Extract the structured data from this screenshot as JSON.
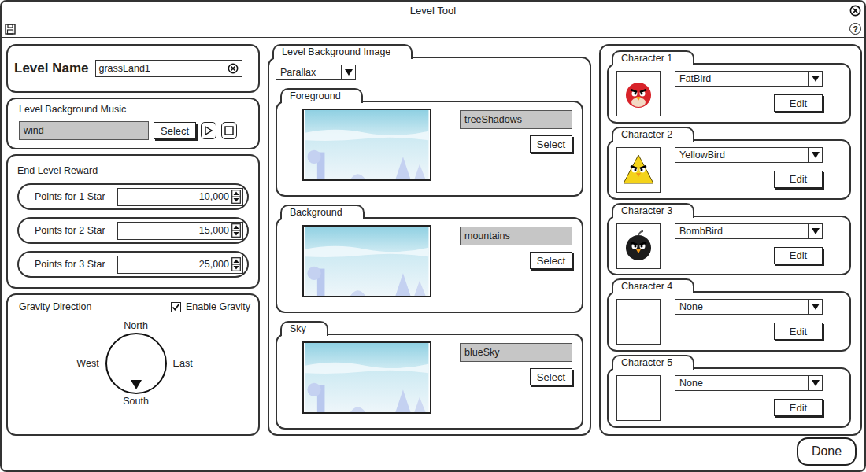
{
  "window": {
    "title": "Level Tool"
  },
  "toolbar": {
    "help": "?"
  },
  "levelName": {
    "label": "Level Name",
    "value": "grassLand1"
  },
  "music": {
    "title": "Level Background Music",
    "value": "wind",
    "button": "Select"
  },
  "reward": {
    "title": "End Level Reward",
    "rows": [
      {
        "label": "Points for 1 Star",
        "value": "10,000"
      },
      {
        "label": "Points for 2 Star",
        "value": "15,000"
      },
      {
        "label": "Points for 3 Star",
        "value": "25,000"
      }
    ]
  },
  "gravity": {
    "title": "Gravity Direction",
    "enable": {
      "label": "Enable Gravity",
      "checked": true
    },
    "directions": [
      {
        "label": "North",
        "selected": false
      },
      {
        "label": "East",
        "selected": false
      },
      {
        "label": "South",
        "selected": true
      },
      {
        "label": "West",
        "selected": false
      }
    ]
  },
  "background": {
    "title": "Level Background Image",
    "mode": "Parallax",
    "layers": [
      {
        "title": "Foreground",
        "image": "treeShadows",
        "button": "Select"
      },
      {
        "title": "Background",
        "image": "mountains",
        "button": "Select"
      },
      {
        "title": "Sky",
        "image": "blueSky",
        "button": "Select"
      }
    ]
  },
  "characters": [
    {
      "title": "Character 1",
      "value": "FatBird",
      "button": "Edit",
      "kind": "round",
      "color": "#d8232a"
    },
    {
      "title": "Character 2",
      "value": "YellowBird",
      "button": "Edit",
      "kind": "triangle",
      "color": "#f4d31a"
    },
    {
      "title": "Character 3",
      "value": "BombBird",
      "button": "Edit",
      "kind": "bomb",
      "color": "#1c1c1c"
    },
    {
      "title": "Character 4",
      "value": "None",
      "button": "Edit",
      "kind": "empty"
    },
    {
      "title": "Character 5",
      "value": "None",
      "button": "Edit",
      "kind": "empty"
    }
  ],
  "footer": {
    "button": "Done"
  }
}
